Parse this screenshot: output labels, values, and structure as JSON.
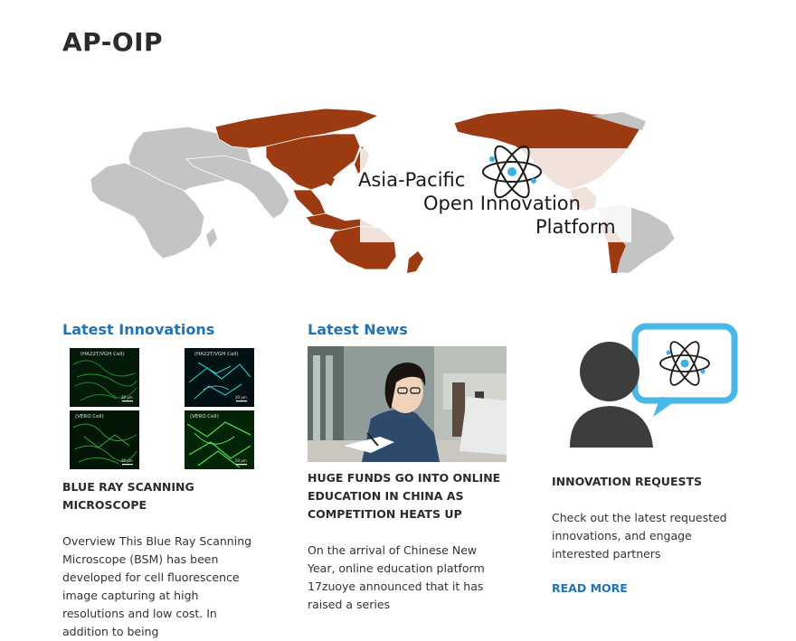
{
  "site": {
    "title": "AP-OIP"
  },
  "banner": {
    "line1": "Asia-Pacific",
    "line2": "Open Innovation",
    "line3": "Platform",
    "colors": {
      "highlight": "#9c3b12",
      "land": "#c4c4c4",
      "atom": "#1c1c1c",
      "nucleus": "#3fb0e6"
    },
    "logo_icon": "atom-icon"
  },
  "innovations": {
    "heading": "Latest Innovations",
    "image_captions": [
      "(HA22T/VGH Cell)",
      "(HA22T/VGH Cell)",
      "(VERO Cell)",
      "(VERO Cell)"
    ],
    "scale_label": "20 µm",
    "item_title": "BLUE RAY SCANNING MICROSCOPE",
    "excerpt": "Overview This Blue Ray Scanning Microscope (BSM) has been developed for cell fluorescence image capturing at high resolutions and low cost. In addition to being"
  },
  "news": {
    "heading": "Latest News",
    "item_title": "HUGE FUNDS GO INTO ONLINE EDUCATION IN CHINA AS COMPETITION HEATS UP",
    "excerpt": "On the arrival of Chinese New Year, online education platform 17zuoye announced that it has raised a series"
  },
  "requests": {
    "item_title": "INNOVATION REQUESTS",
    "excerpt": "Check out the latest requested innovations, and engage interested partners",
    "read_more": "READ MORE",
    "icon": "person-idea-icon",
    "colors": {
      "person": "#3d3d3d",
      "bubble": "#49b7e8"
    }
  },
  "colors": {
    "link": "#1f74b8",
    "text": "#2b2b2b"
  }
}
